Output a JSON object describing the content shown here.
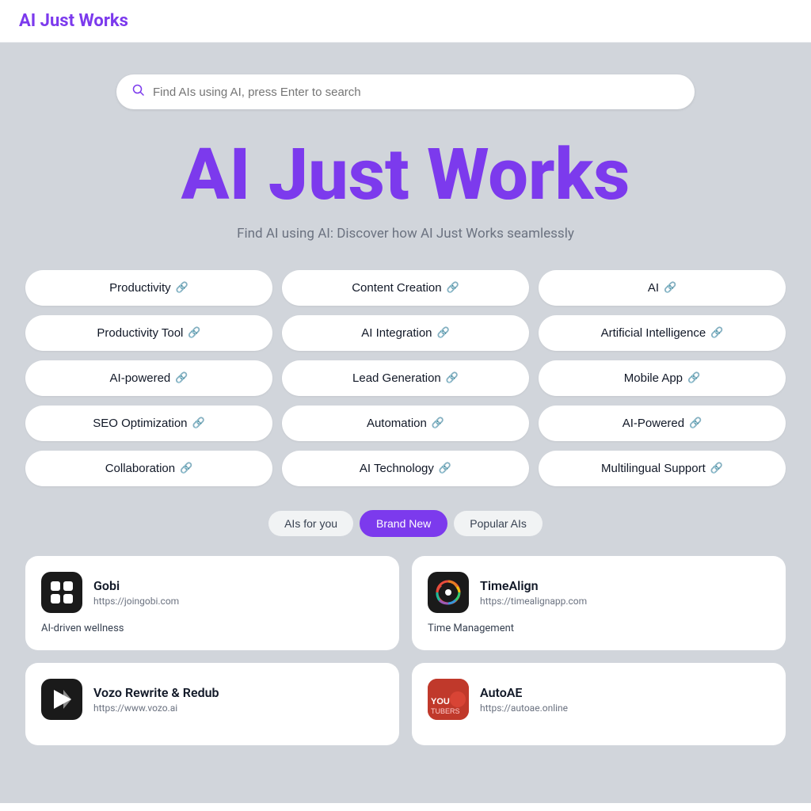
{
  "header": {
    "logo": "AI Just Works"
  },
  "search": {
    "placeholder": "Find AIs using AI, press Enter to search"
  },
  "hero": {
    "title": "AI Just Works",
    "subtitle": "Find AI using AI: Discover how AI Just Works seamlessly"
  },
  "tags": [
    {
      "label": "Productivity",
      "col": 0
    },
    {
      "label": "Content Creation",
      "col": 1
    },
    {
      "label": "AI",
      "col": 2
    },
    {
      "label": "Productivity Tool",
      "col": 0
    },
    {
      "label": "AI Integration",
      "col": 1
    },
    {
      "label": "Artificial Intelligence",
      "col": 2
    },
    {
      "label": "AI-powered",
      "col": 0
    },
    {
      "label": "Lead Generation",
      "col": 1
    },
    {
      "label": "Mobile App",
      "col": 2
    },
    {
      "label": "SEO Optimization",
      "col": 0
    },
    {
      "label": "Automation",
      "col": 1
    },
    {
      "label": "AI-Powered",
      "col": 2
    },
    {
      "label": "Collaboration",
      "col": 0
    },
    {
      "label": "AI Technology",
      "col": 1
    },
    {
      "label": "Multilingual Support",
      "col": 2
    }
  ],
  "filters": [
    {
      "label": "AIs for you",
      "active": false
    },
    {
      "label": "Brand New",
      "active": true
    },
    {
      "label": "Popular AIs",
      "active": false
    }
  ],
  "cards": [
    {
      "id": "gobi",
      "name": "Gobi",
      "url": "https://joingobi.com",
      "description": "AI-driven wellness",
      "logo_type": "gobi"
    },
    {
      "id": "timealign",
      "name": "TimeAlign",
      "url": "https://timealignapp.com",
      "description": "Time Management",
      "logo_type": "timealign"
    },
    {
      "id": "vozo",
      "name": "Vozo Rewrite & Redub",
      "url": "https://www.vozo.ai",
      "description": "",
      "logo_type": "vozo"
    },
    {
      "id": "autoae",
      "name": "AutoAE",
      "url": "https://autoae.online",
      "description": "",
      "logo_type": "autoae"
    }
  ]
}
